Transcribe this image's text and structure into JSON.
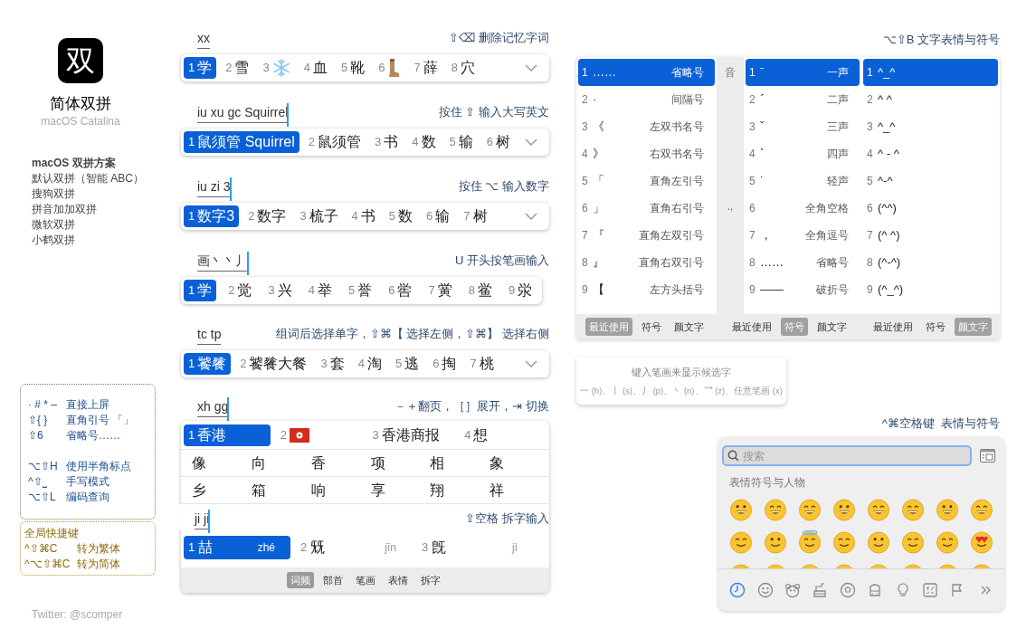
{
  "app": {
    "logo": "双",
    "title": "简体双拼",
    "subtitle": "macOS Catalina"
  },
  "schemes": {
    "heading": "macOS 双拼方案",
    "items": [
      "默认双拼（智能 ABC）",
      "搜狗双拼",
      "拼音加加双拼",
      "微软双拼",
      "小鹤双拼"
    ]
  },
  "shortcuts": {
    "groups": [
      [
        {
          "keys": "· # * –",
          "desc": "直接上屏"
        },
        {
          "keys": "⇧{ }",
          "desc": "直角引号 「」"
        },
        {
          "keys": "⇧6",
          "desc": "省略号……"
        }
      ],
      [
        {
          "keys": "⌥⇧H",
          "desc": "使用半角标点"
        },
        {
          "keys": "^⇧⎵",
          "desc": "手写模式"
        },
        {
          "keys": "⌥⇧L",
          "desc": "编码查询"
        }
      ]
    ]
  },
  "global_shortcuts": {
    "title": "全局快捷键",
    "items": [
      {
        "keys": "^⇧⌘C",
        "desc": "转为繁体"
      },
      {
        "keys": "^⌥⇧⌘C",
        "desc": "转为简体"
      }
    ]
  },
  "credit": "Twitter: @scomper",
  "examples": [
    {
      "input": "xx",
      "cursor": false,
      "hint": "⇧⌫ 删除记忆字词",
      "expandable": true,
      "candidates": [
        {
          "num": "1",
          "kind": "text",
          "text": "学",
          "selected": true
        },
        {
          "num": "2",
          "kind": "text",
          "text": "雪",
          "selected": false
        },
        {
          "num": "3",
          "kind": "snowflake",
          "selected": false
        },
        {
          "num": "4",
          "kind": "text",
          "text": "血",
          "selected": false
        },
        {
          "num": "5",
          "kind": "text",
          "text": "靴",
          "selected": false
        },
        {
          "num": "6",
          "kind": "boot",
          "selected": false
        },
        {
          "num": "7",
          "kind": "text",
          "text": "薛",
          "selected": false
        },
        {
          "num": "8",
          "kind": "text",
          "text": "穴",
          "selected": false
        }
      ]
    },
    {
      "input": "iu xu gc Squirrel",
      "cursor": true,
      "hint": "按住 ⇧ 输入大写英文",
      "expandable": true,
      "candidates": [
        {
          "num": "1",
          "kind": "text",
          "text": "鼠须管 Squirrel",
          "selected": true
        },
        {
          "num": "2",
          "kind": "text",
          "text": "鼠须管",
          "selected": false
        },
        {
          "num": "3",
          "kind": "text",
          "text": "书",
          "selected": false
        },
        {
          "num": "4",
          "kind": "text",
          "text": "数",
          "selected": false
        },
        {
          "num": "5",
          "kind": "text",
          "text": "输",
          "selected": false
        },
        {
          "num": "6",
          "kind": "text",
          "text": "树",
          "selected": false
        }
      ]
    },
    {
      "input": "iu zi 3",
      "cursor": true,
      "hint": "按住 ⌥ 输入数字",
      "expandable": true,
      "candidates": [
        {
          "num": "1",
          "kind": "text",
          "text": "数字3",
          "selected": true
        },
        {
          "num": "2",
          "kind": "text",
          "text": "数字",
          "selected": false
        },
        {
          "num": "3",
          "kind": "text",
          "text": "梳子",
          "selected": false
        },
        {
          "num": "4",
          "kind": "text",
          "text": "书",
          "selected": false
        },
        {
          "num": "5",
          "kind": "text",
          "text": "数",
          "selected": false
        },
        {
          "num": "6",
          "kind": "text",
          "text": "输",
          "selected": false
        },
        {
          "num": "7",
          "kind": "text",
          "text": "树",
          "selected": false
        }
      ]
    },
    {
      "input": "画丶丶丿",
      "cursor": true,
      "hint": "U 开头按笔画输入",
      "expandable": false,
      "candidates": [
        {
          "num": "1",
          "kind": "text",
          "text": "学",
          "selected": true
        },
        {
          "num": "2",
          "kind": "text",
          "text": "觉",
          "selected": false
        },
        {
          "num": "3",
          "kind": "text",
          "text": "兴",
          "selected": false
        },
        {
          "num": "4",
          "kind": "text",
          "text": "举",
          "selected": false
        },
        {
          "num": "5",
          "kind": "text",
          "text": "誉",
          "selected": false
        },
        {
          "num": "6",
          "kind": "text",
          "text": "喾",
          "selected": false
        },
        {
          "num": "7",
          "kind": "text",
          "text": "黉",
          "selected": false
        },
        {
          "num": "8",
          "kind": "text",
          "text": "鲎",
          "selected": false
        },
        {
          "num": "9",
          "kind": "text",
          "text": "泶",
          "selected": false
        }
      ]
    },
    {
      "input": "tc tp",
      "cursor": false,
      "hint": "组词后选择单字，⇧⌘【 选择左侧，⇧⌘】 选择右侧",
      "expandable": true,
      "candidates": [
        {
          "num": "1",
          "kind": "text",
          "text": "饕餮",
          "selected": true
        },
        {
          "num": "2",
          "kind": "text",
          "text": "饕餮大餐",
          "selected": false
        },
        {
          "num": "3",
          "kind": "text",
          "text": "套",
          "selected": false
        },
        {
          "num": "4",
          "kind": "text",
          "text": "淘",
          "selected": false
        },
        {
          "num": "5",
          "kind": "text",
          "text": "逃",
          "selected": false
        },
        {
          "num": "6",
          "kind": "text",
          "text": "掏",
          "selected": false
        },
        {
          "num": "7",
          "kind": "text",
          "text": "桃",
          "selected": false
        }
      ]
    }
  ],
  "expanded_example": {
    "input": "xh gg",
    "cursor": true,
    "hint": "－＋翻页，［］展开，⇥ 切换",
    "candidates": [
      {
        "num": "1",
        "kind": "text",
        "text": "香港",
        "selected": true
      },
      {
        "num": "2",
        "kind": "flag",
        "selected": false
      },
      {
        "num": "3",
        "kind": "text",
        "text": "香港商报",
        "selected": false
      },
      {
        "num": "4",
        "kind": "text",
        "text": "想",
        "selected": false
      }
    ],
    "grid_rows": [
      [
        "像",
        "向",
        "香",
        "项",
        "相",
        "象"
      ],
      [
        "乡",
        "箱",
        "响",
        "享",
        "翔",
        "祥"
      ]
    ],
    "split_example": {
      "input": "ji ji",
      "cursor": true,
      "hint": "⇧空格 拆字输入",
      "candidates": [
        {
          "num": "1",
          "text": "喆",
          "pinyin": "zhé",
          "selected": true
        },
        {
          "num": "2",
          "text": "兓",
          "pinyin": "jīn",
          "selected": false
        },
        {
          "num": "3",
          "text": "旣",
          "pinyin": "jì",
          "selected": false
        }
      ],
      "tabs": [
        {
          "label": "词频",
          "selected": true
        },
        {
          "label": "部首",
          "selected": false
        },
        {
          "label": "笔画",
          "selected": false
        },
        {
          "label": "表情",
          "selected": false
        },
        {
          "label": "拆字",
          "selected": false
        }
      ]
    }
  },
  "symbol_hint": "⌥⇧B 文字表情与符号",
  "symbol_panels": [
    {
      "items": [
        {
          "num": "1",
          "symbol": "……",
          "name": "省略号",
          "selected": true
        },
        {
          "num": "2",
          "symbol": "·",
          "name": "间隔号",
          "selected": false
        },
        {
          "num": "3",
          "symbol": "《",
          "name": "左双书名号",
          "selected": false
        },
        {
          "num": "4",
          "symbol": "》",
          "name": "右双书名号",
          "selected": false
        },
        {
          "num": "5",
          "symbol": "「",
          "name": "直角左引号",
          "selected": false
        },
        {
          "num": "6",
          "symbol": "」",
          "name": "直角右引号",
          "selected": false
        },
        {
          "num": "7",
          "symbol": "『",
          "name": "直角左双引号",
          "selected": false
        },
        {
          "num": "8",
          "symbol": "』",
          "name": "直角右双引号",
          "selected": false
        },
        {
          "num": "9",
          "symbol": "【",
          "name": "左方头括号",
          "selected": false
        }
      ],
      "tabs": [
        {
          "label": "最近使用",
          "selected": true
        },
        {
          "label": "符号",
          "selected": false
        },
        {
          "label": "颜文字",
          "selected": false
        }
      ]
    },
    {
      "sidebar": [
        "音",
        ".,"
      ],
      "items": [
        {
          "num": "1",
          "symbol": "ˉ",
          "name": "一声",
          "selected": true
        },
        {
          "num": "2",
          "symbol": "ˊ",
          "name": "二声",
          "selected": false
        },
        {
          "num": "3",
          "symbol": "ˇ",
          "name": "三声",
          "selected": false
        },
        {
          "num": "4",
          "symbol": "ˋ",
          "name": "四声",
          "selected": false
        },
        {
          "num": "5",
          "symbol": "˙",
          "name": "轻声",
          "selected": false
        },
        {
          "num": "6",
          "name": "全角空格",
          "selected": false
        },
        {
          "num": "7",
          "symbol": "，",
          "name": "全角逗号",
          "selected": false
        },
        {
          "num": "8",
          "symbol": "……",
          "name": "省略号",
          "selected": false
        },
        {
          "num": "9",
          "symbol": "——",
          "name": "破折号",
          "selected": false
        }
      ],
      "tabs": [
        {
          "label": "最近使用",
          "selected": false
        },
        {
          "label": "符号",
          "selected": true
        },
        {
          "label": "颜文字",
          "selected": false
        }
      ]
    },
    {
      "items": [
        {
          "num": "1",
          "symbol": "^_^",
          "selected": true
        },
        {
          "num": "2",
          "symbol": "^ ^",
          "selected": false
        },
        {
          "num": "3",
          "symbol": "^_^",
          "selected": false
        },
        {
          "num": "4",
          "symbol": "^ - ^",
          "selected": false
        },
        {
          "num": "5",
          "symbol": "^-^",
          "selected": false
        },
        {
          "num": "6",
          "symbol": "(^^)",
          "selected": false
        },
        {
          "num": "7",
          "symbol": "(^ ^)",
          "selected": false
        },
        {
          "num": "8",
          "symbol": "(^-^)",
          "selected": false
        },
        {
          "num": "9",
          "symbol": "(^_^)",
          "selected": false
        }
      ],
      "tabs": [
        {
          "label": "最近使用",
          "selected": false
        },
        {
          "label": "符号",
          "selected": false
        },
        {
          "label": "颜文字",
          "selected": true
        }
      ]
    }
  ],
  "stroke_panel": {
    "prompt": "键入笔画来显示候选字",
    "strokes": "一 (h)、丨 (s)、丿 (p)、丶 (n)、乛 (z)、任意笔画 (x)"
  },
  "emoji_hint": "^⌘空格键  表情与符号",
  "emoji_panel": {
    "search": {
      "placeholder": "搜索"
    },
    "section": "表情符号与人物",
    "categories": [
      {
        "kind": "recent",
        "selected": true
      },
      {
        "kind": "smileys",
        "selected": false
      },
      {
        "kind": "animals",
        "selected": false
      },
      {
        "kind": "food",
        "selected": false
      },
      {
        "kind": "activity",
        "selected": false
      },
      {
        "kind": "travel",
        "selected": false
      },
      {
        "kind": "objects",
        "selected": false
      },
      {
        "kind": "symbols",
        "selected": false
      },
      {
        "kind": "flags",
        "selected": false
      },
      {
        "kind": "more",
        "selected": false
      }
    ]
  }
}
